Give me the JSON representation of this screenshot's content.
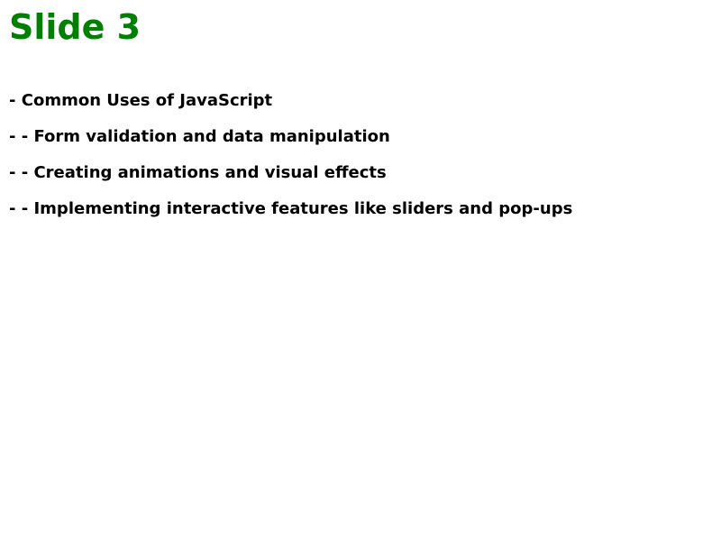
{
  "slide": {
    "title": "Slide 3",
    "title_color": "#008000",
    "bullets": [
      "- Common Uses of JavaScript",
      "- - Form validation and data manipulation",
      "- - Creating animations and visual effects",
      "- - Implementing interactive features like sliders and pop-ups"
    ]
  }
}
